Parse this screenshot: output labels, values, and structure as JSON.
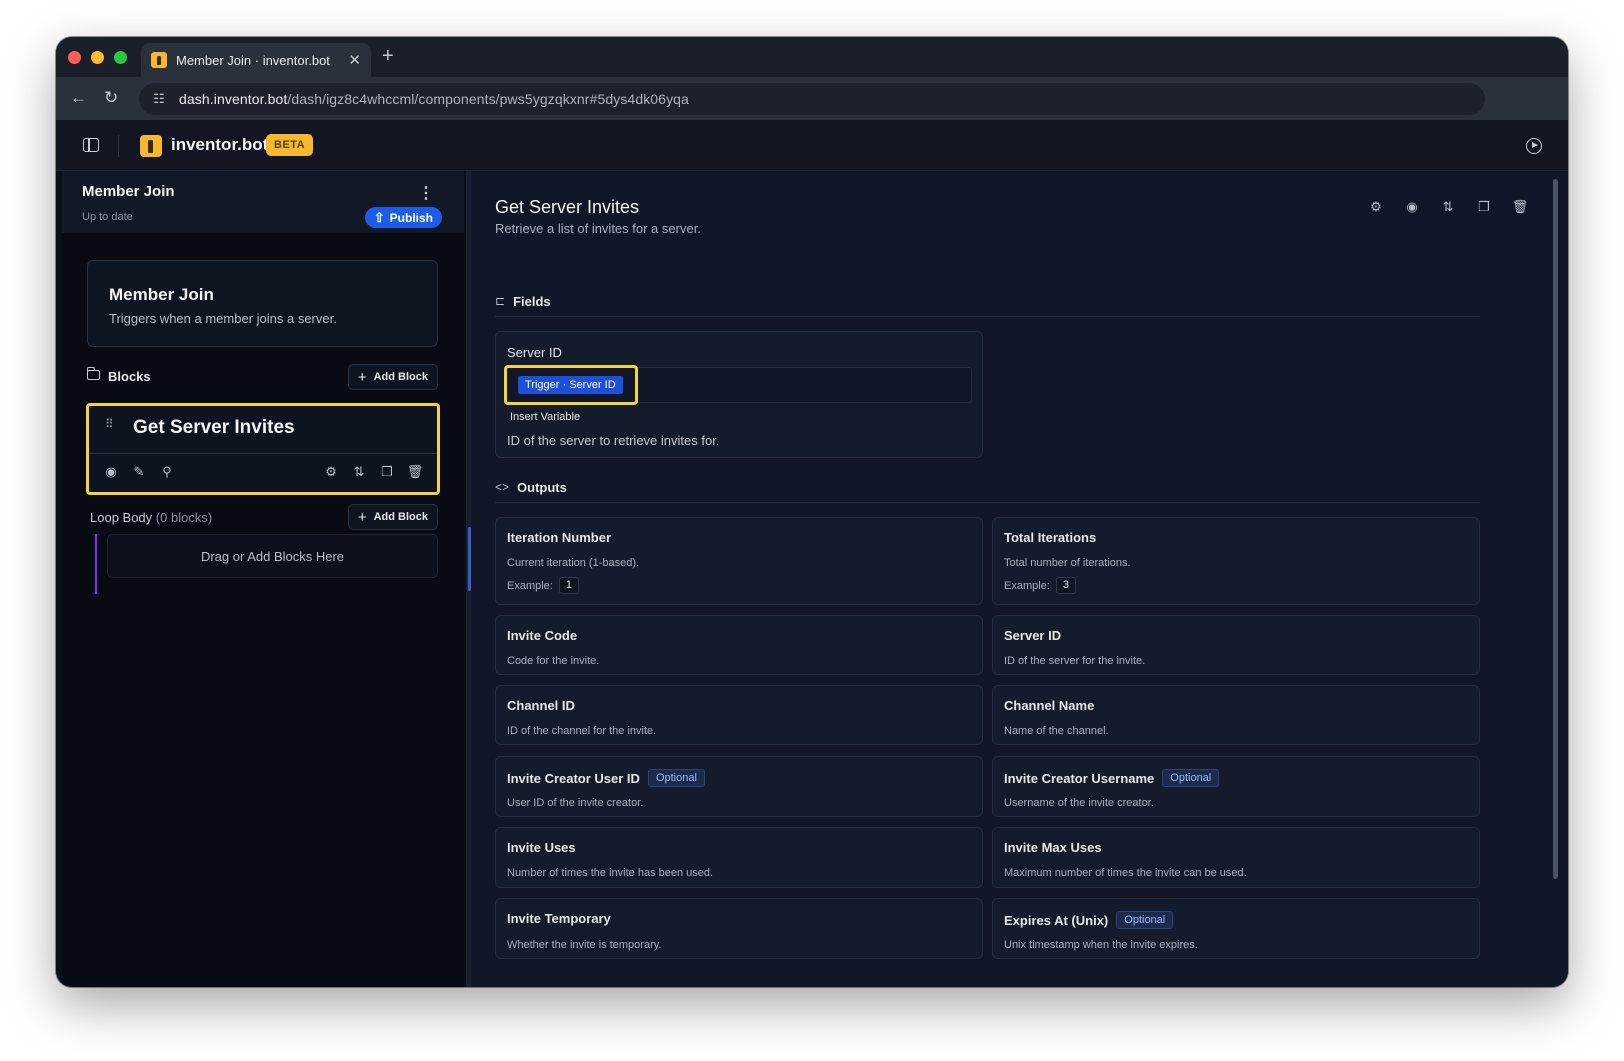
{
  "browser": {
    "tab_title": "Member Join · inventor.bot",
    "url_host": "dash.inventor.bot",
    "url_path": "/dash/igz8c4whccml/components/pws5ygzqkxnr#5dys4dk06yqa"
  },
  "app": {
    "brand": "inventor.bot",
    "badge": "BETA"
  },
  "left_panel": {
    "title": "Member Join",
    "status": "Up to date",
    "publish_label": "Publish",
    "trigger": {
      "title": "Member Join",
      "description": "Triggers when a member joins a server."
    },
    "blocks_label": "Blocks",
    "add_block_label": "Add Block",
    "block": {
      "title": "Get Server Invites"
    },
    "loop": {
      "label": "Loop Body",
      "count": "(0 blocks)",
      "add_block_label": "Add Block",
      "drop_hint": "Drag or Add Blocks Here"
    }
  },
  "detail": {
    "title": "Get Server Invites",
    "description": "Retrieve a list of invites for a server.",
    "fields_label": "Fields",
    "field": {
      "label": "Server ID",
      "chip": "Trigger · Server ID",
      "insert_label": "Insert Variable",
      "help": "ID of the server to retrieve invites for."
    },
    "outputs_label": "Outputs",
    "example_label": "Example:",
    "optional_label": "Optional",
    "outputs": [
      {
        "name": "Iteration Number",
        "desc": "Current iteration (1-based).",
        "example": "1"
      },
      {
        "name": "Total Iterations",
        "desc": "Total number of iterations.",
        "example": "3"
      },
      {
        "name": "Invite Code",
        "desc": "Code for the invite."
      },
      {
        "name": "Server ID",
        "desc": "ID of the server for the invite."
      },
      {
        "name": "Channel ID",
        "desc": "ID of the channel for the invite."
      },
      {
        "name": "Channel Name",
        "desc": "Name of the channel."
      },
      {
        "name": "Invite Creator User ID",
        "desc": "User ID of the invite creator.",
        "optional": true
      },
      {
        "name": "Invite Creator Username",
        "desc": "Username of the invite creator.",
        "optional": true
      },
      {
        "name": "Invite Uses",
        "desc": "Number of times the invite has been used."
      },
      {
        "name": "Invite Max Uses",
        "desc": "Maximum number of times the invite can be used."
      },
      {
        "name": "Invite Temporary",
        "desc": "Whether the invite is temporary."
      },
      {
        "name": "Expires At (Unix)",
        "desc": "Unix timestamp when the invite expires.",
        "optional": true
      }
    ]
  },
  "colors": {
    "accent": "#1d5ce8",
    "highlight": "#f4d33d",
    "brand": "#f5b82e",
    "loop_bar": "#7c3aed"
  }
}
